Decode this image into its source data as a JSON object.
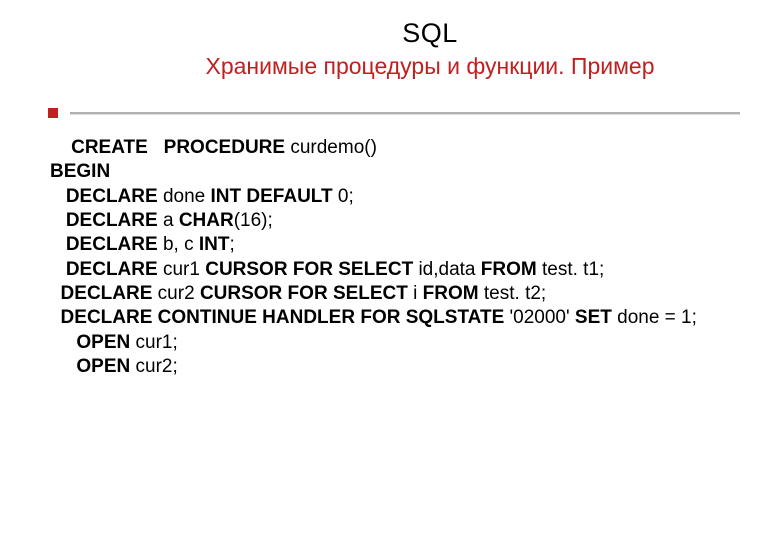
{
  "header": {
    "title": "SQL",
    "subtitle": "Хранимые процедуры и функции. Пример"
  },
  "code": {
    "l1a": "    CREATE   PROCEDURE",
    "l1b": " curdemo()",
    "l2": "BEGIN",
    "l3a": "   DECLARE",
    "l3b": " done ",
    "l3c": "INT DEFAULT",
    "l3d": " 0;",
    "l4a": "   DECLARE",
    "l4b": " a ",
    "l4c": "CHAR",
    "l4d": "(16);",
    "l5a": "   DECLARE",
    "l5b": " b, c ",
    "l5c": "INT",
    "l5d": ";",
    "l6a": "   DECLARE",
    "l6b": " cur1 ",
    "l6c": "CURSOR FOR SELECT",
    "l6d": " id,data ",
    "l6e": "FROM",
    "l6f": " test. t1;",
    "l7a": "  DECLARE",
    "l7b": " cur2 ",
    "l7c": "CURSOR FOR SELECT",
    "l7d": " i ",
    "l7e": "FROM",
    "l7f": " test. t2;",
    "l8a": "  DECLARE CONTINUE HANDLER FOR SQLSTATE",
    "l8b": " '02000' ",
    "l8c": "SET",
    "l8d": " done = 1;",
    "l9a": "     OPEN",
    "l9b": " cur1;",
    "l10a": "     OPEN",
    "l10b": " cur2;"
  }
}
